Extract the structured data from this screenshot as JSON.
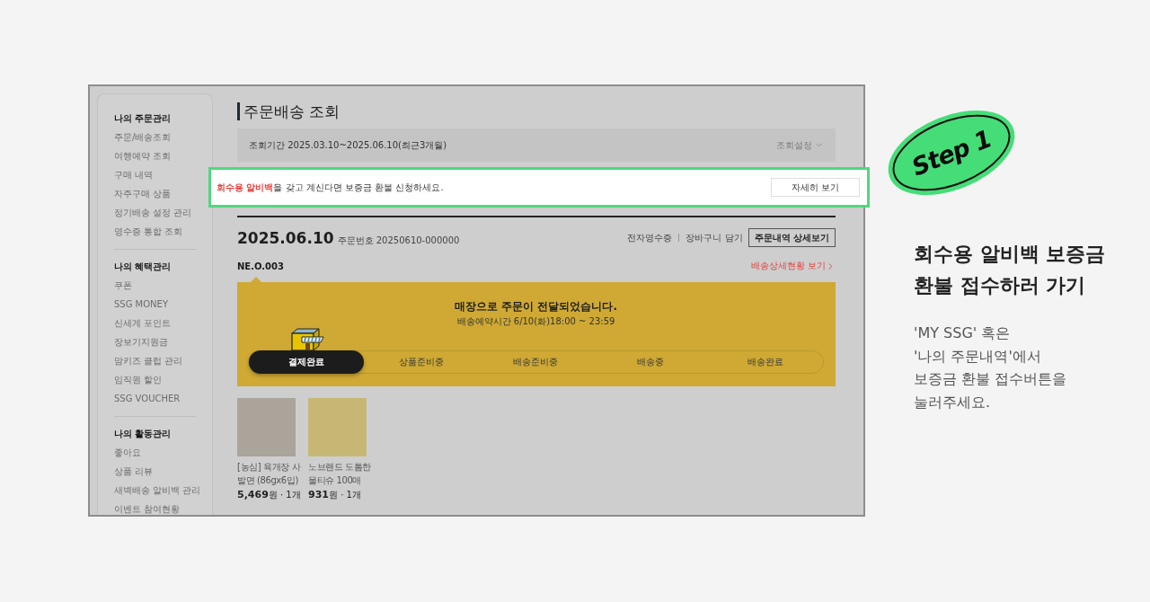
{
  "sidebar": {
    "sections": [
      {
        "title": "나의 주문관리",
        "items": [
          "주문/배송조회",
          "여행예약 조회",
          "구매 내역",
          "자주구매 상품",
          "정기배송 설정 관리",
          "영수증 통합 조회"
        ]
      },
      {
        "title": "나의 혜택관리",
        "items": [
          "쿠폰",
          "SSG MONEY",
          "신세계 포인트",
          "장보기지원금",
          "맘키즈 클럽 관리",
          "임직원 할인",
          "SSG VOUCHER"
        ]
      },
      {
        "title": "나의 활동관리",
        "items": [
          "좋아요",
          "상품 리뷰",
          "새벽배송 알비백 관리",
          "이벤트 참여현황"
        ]
      }
    ]
  },
  "page_title": "주문배송 조회",
  "period_filter": {
    "label": "조회기간 2025.03.10~2025.06.10(최근3개월)",
    "settings": "조회설정"
  },
  "notice": {
    "text": "**회수용 알비백**을 갖고 계신다면 보증금 환불 신청하세요.",
    "button": "자세히 보기",
    "highlighted": true
  },
  "order": {
    "date": "2025.06.10",
    "number": "주문번호 20250610-000000",
    "links": [
      "전자영수증",
      "장바구니 담기"
    ],
    "detail_button": "주문내역 상세보기",
    "store_code": "NE.O.003",
    "tracking_link": "배송상세현황 보기"
  },
  "status": {
    "title": "매장으로 주문이 전달되었습니다.",
    "subtitle": "배송예약시간 6/10(화)18:00 ~ 23:59",
    "steps": [
      {
        "label": "결제완료",
        "selected": true
      },
      {
        "label": "상품준비중",
        "selected": false
      },
      {
        "label": "배송준비중",
        "selected": false
      },
      {
        "label": "배송중",
        "selected": false
      },
      {
        "label": "배송완료",
        "selected": false
      }
    ]
  },
  "products": [
    {
      "name": "[농심] 육개장 사발면 (86gx6입)",
      "price": "**5,469**원 · 1개"
    },
    {
      "name": "노브랜드 도톰한 물티슈 100매",
      "price": "**931**원 · 1개"
    }
  ],
  "guide": {
    "badge": "Step 1",
    "heading": [
      "회수용 알비백 보증금",
      "환불 접수하러 가기"
    ],
    "description": [
      "'MY SSG' 혹은",
      "'나의 주문내역'에서",
      "보증금 환불 접수버튼을",
      "눌러주세요."
    ]
  }
}
